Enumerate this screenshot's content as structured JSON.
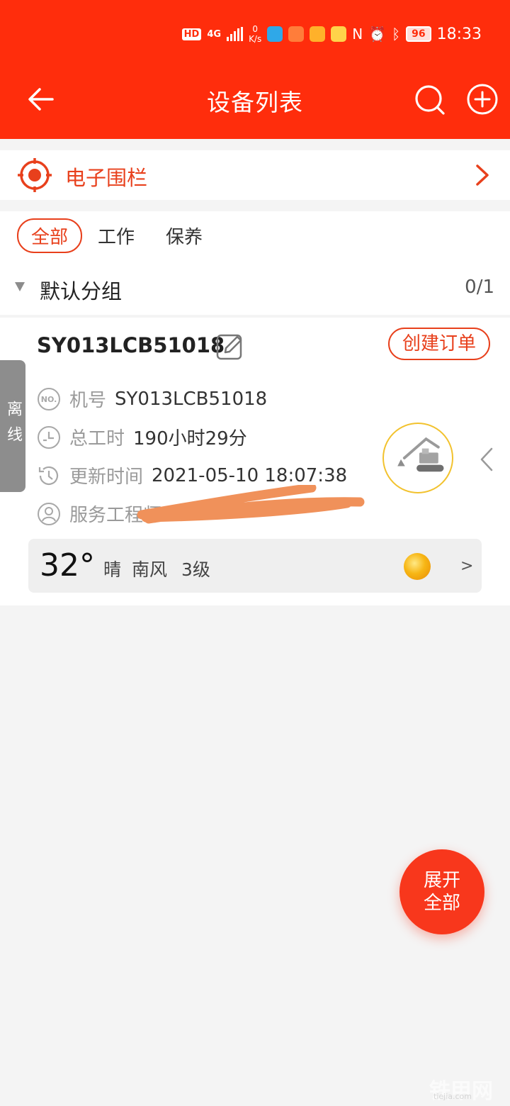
{
  "status_bar": {
    "network": "HD",
    "signal": "4G",
    "speed_value": "0",
    "speed_unit": "K/s",
    "battery": "96",
    "time": "18:33"
  },
  "header": {
    "title": "设备列表",
    "background_color": "#ff2d0c"
  },
  "fence": {
    "label": "电子围栏"
  },
  "filters": {
    "tabs": [
      {
        "label": "全部",
        "active": true
      },
      {
        "label": "工作",
        "active": false
      },
      {
        "label": "保养",
        "active": false
      }
    ]
  },
  "group": {
    "name": "默认分组",
    "count": "0/1"
  },
  "device": {
    "status_label": "离线",
    "id": "SY013LCB51018",
    "order_button": "创建订单",
    "rows": [
      {
        "key": "机号",
        "value": "SY013LCB51018",
        "icon": "serial-number-icon"
      },
      {
        "key": "总工时",
        "value": "190小时29分",
        "icon": "work-hours-icon"
      },
      {
        "key": "更新时间",
        "value": "2021-05-10 18:07:38",
        "icon": "history-clock-icon"
      },
      {
        "key": "服务工程师",
        "value": "",
        "icon": "engineer-icon"
      }
    ],
    "weather": {
      "temp": "32°",
      "condition": "晴",
      "wind": "南风",
      "level": "3级",
      "arrow": ">"
    }
  },
  "fab": {
    "line1": "展开",
    "line2": "全部"
  },
  "watermark": {
    "text": "铁甲网",
    "sub": "tiejia.com"
  },
  "accent_color": "#e8401c"
}
